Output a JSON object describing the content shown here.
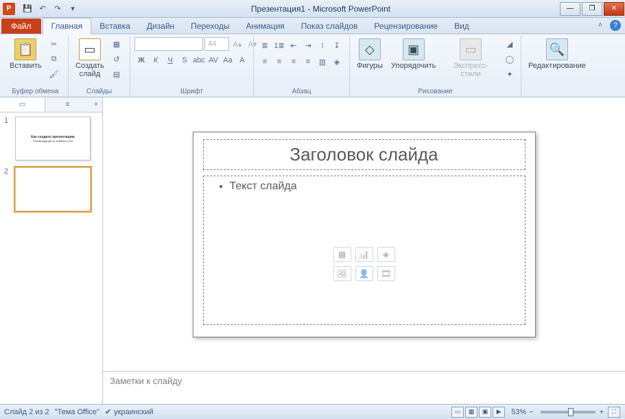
{
  "title": "Презентация1 - Microsoft PowerPoint",
  "qat": {
    "save": "save",
    "undo": "undo",
    "redo": "redo"
  },
  "tabs": {
    "file": "Файл",
    "items": [
      "Главная",
      "Вставка",
      "Дизайн",
      "Переходы",
      "Анимация",
      "Показ слайдов",
      "Рецензирование",
      "Вид"
    ],
    "active": 0
  },
  "ribbon": {
    "clipboard": {
      "label": "Буфер обмена",
      "paste": "Вставить"
    },
    "slides": {
      "label": "Слайды",
      "new_slide": "Создать\nслайд"
    },
    "font": {
      "label": "Шрифт",
      "size": "44"
    },
    "paragraph": {
      "label": "Абзац"
    },
    "drawing": {
      "label": "Рисование",
      "shapes": "Фигуры",
      "arrange": "Упорядочить",
      "styles": "Экспресс-стили"
    },
    "editing": {
      "label": "Редактирование",
      "btn": "Редактирование"
    }
  },
  "thumbs": {
    "tab_slides_icon": "▭",
    "tab_outline_icon": "≡",
    "slides": [
      {
        "num": "1",
        "title": "Как создать презентацию",
        "sub": "Рекомендации от softikbox.com",
        "selected": false
      },
      {
        "num": "2",
        "title": "",
        "sub": "",
        "selected": true
      }
    ]
  },
  "slide": {
    "title_placeholder": "Заголовок слайда",
    "body_placeholder": "Текст слайда",
    "icons": {
      "table": "▦",
      "chart": "📊",
      "smartart": "◈",
      "picture": "🖼",
      "clipart": "👤",
      "media": "🎞"
    }
  },
  "notes": {
    "placeholder": "Заметки к слайду"
  },
  "status": {
    "slide_info": "Слайд 2 из 2",
    "theme": "\"Тема Office\"",
    "language": "украинский",
    "zoom": "53%"
  },
  "window": {
    "min": "—",
    "max": "❐",
    "close": "✕"
  },
  "help": {
    "minimize_ribbon": "˄",
    "help": "?"
  }
}
